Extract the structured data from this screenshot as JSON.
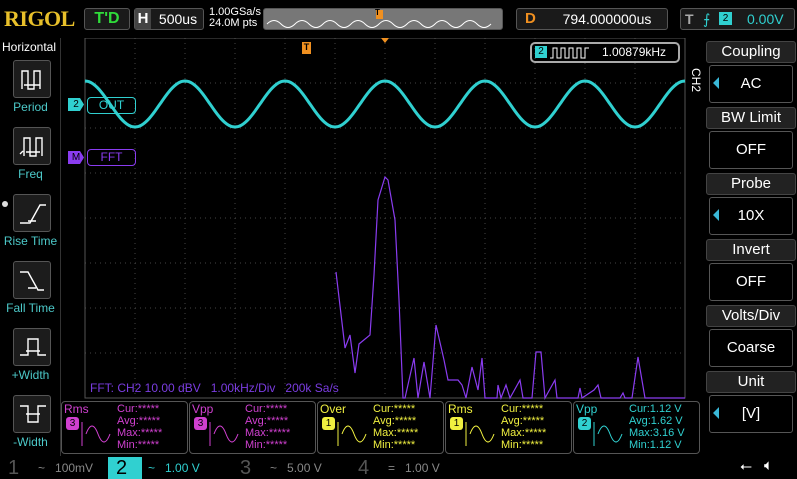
{
  "header": {
    "logo": "RIGOL",
    "run_state": "T'D",
    "horizontal_label": "H",
    "timebase": "500us",
    "sample_rate": "1.00GSa/s",
    "memory_depth": "24.0M pts",
    "delay_label": "D",
    "delay": "794.000000us",
    "trigger_label": "T",
    "trigger_slope": "rising-edge-icon",
    "trigger_source": "2",
    "trigger_level": "0.00V"
  },
  "left_panel": {
    "title": "Horizontal",
    "items": [
      {
        "label": "Period",
        "icon": "period-icon"
      },
      {
        "label": "Freq",
        "icon": "frequency-icon"
      },
      {
        "label": "Rise Time",
        "icon": "rise-time-icon"
      },
      {
        "label": "Fall Time",
        "icon": "fall-time-icon"
      },
      {
        "label": "+Width",
        "icon": "positive-width-icon"
      },
      {
        "label": "-Width",
        "icon": "negative-width-icon"
      }
    ]
  },
  "waveform": {
    "trigger_marker": "T",
    "freq_counter": {
      "channel": "2",
      "value": "1.00879kHz"
    },
    "ch2_label": {
      "channel": "2",
      "text": "OUT"
    },
    "math_label": {
      "channel": "M",
      "text": "FFT"
    },
    "fft_info": "FFT: CH2 10.00 dBV   1.00kHz/Div   200k Sa/s"
  },
  "right_menu": {
    "channel": "CH2",
    "items": [
      {
        "title": "Coupling",
        "value": "AC",
        "arrow": true
      },
      {
        "title": "BW Limit",
        "value": "OFF",
        "arrow": false
      },
      {
        "title": "Probe",
        "value": "10X",
        "arrow": true
      },
      {
        "title": "Invert",
        "value": "OFF",
        "arrow": false
      },
      {
        "title": "Volts/Div",
        "value": "Coarse",
        "arrow": false
      },
      {
        "title": "Unit",
        "value": "[V]",
        "arrow": true
      }
    ]
  },
  "measurements": [
    {
      "name": "Rms",
      "source": "3",
      "color": "#d040d0",
      "cur": "Cur:*****",
      "avg": "Avg:*****",
      "max": "Max:*****",
      "min": "Min:*****"
    },
    {
      "name": "Vpp",
      "source": "3",
      "color": "#d040d0",
      "cur": "Cur:*****",
      "avg": "Avg:*****",
      "max": "Max:*****",
      "min": "Min:*****"
    },
    {
      "name": "Over",
      "source": "1",
      "color": "#f0f040",
      "cur": "Cur:*****",
      "avg": "Avg:*****",
      "max": "Max:*****",
      "min": "Min:*****"
    },
    {
      "name": "Rms",
      "source": "1",
      "color": "#f0f040",
      "cur": "Cur:*****",
      "avg": "Avg:*****",
      "max": "Max:*****",
      "min": "Min:*****"
    },
    {
      "name": "Vpp",
      "source": "2",
      "color": "#30d0d0",
      "cur": "Cur:1.12 V",
      "avg": "Avg:1.62 V",
      "max": "Max:3.16 V",
      "min": "Min:1.12 V"
    }
  ],
  "channels": [
    {
      "num": "1",
      "coupling": "~",
      "scale": "100mV"
    },
    {
      "num": "2",
      "coupling": "~",
      "scale": "1.00 V"
    },
    {
      "num": "3",
      "coupling": "~",
      "scale": "5.00 V"
    },
    {
      "num": "4",
      "coupling": "=",
      "scale": "1.00 V"
    }
  ],
  "colors": {
    "ch1": "#f0f040",
    "ch2": "#30d0d0",
    "ch3": "#d040d0",
    "math": "#8a3cf0",
    "trigger": "#f09020"
  }
}
